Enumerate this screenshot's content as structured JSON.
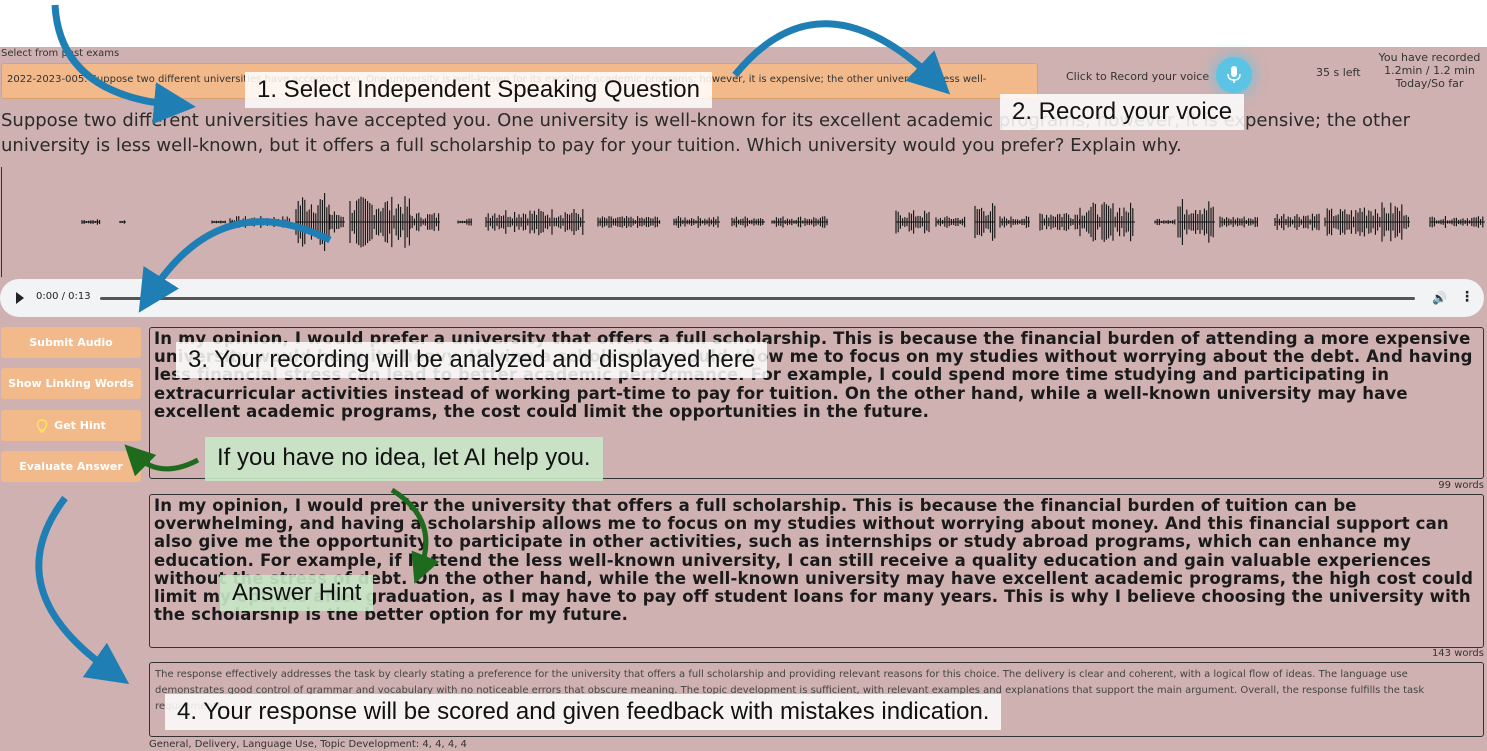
{
  "header": {
    "select_label": "Select from past exams",
    "selected_question": "2022-2023-005. Suppose two different universities have accepted you. One university is well-known for its excellent academic programs; however, it is expensive; the other university is less well-",
    "record_label": "Click to Record your voice",
    "timer": "35 s left",
    "stats_line1": "You have recorded",
    "stats_line2": "1.2min / 1.2 min",
    "stats_line3": "Today/So far"
  },
  "question_text": "Suppose two different universities have accepted you. One university is well-known for its excellent academic programs; however, it is expensive; the other university is less well-known, but it offers a full scholarship to pay for your tuition. Which university would you prefer? Explain why.",
  "audio": {
    "time": "0:00 / 0:13"
  },
  "buttons": {
    "submit": "Submit Audio",
    "linking": "Show Linking Words",
    "hint": "Get Hint",
    "evaluate": "Evaluate Answer"
  },
  "transcript": {
    "text": "In my opinion, I would prefer a university that offers a full scholarship. This is because the financial burden of attending a more expensive university would be quite heavy. Having a scholarship would allow me to focus on my studies without worrying about the debt. And having less financial stress can lead to better academic performance. For example, I could spend more time studying and participating in extracurricular activities instead of working part-time to pay for tuition. On the other hand, while a well-known university may have excellent academic programs, the cost could limit the opportunities in the future.",
    "word_count": "99 words"
  },
  "hint": {
    "text": "In my opinion, I would prefer the university that offers a full scholarship. This is because the financial burden of tuition can be overwhelming, and having a scholarship allows me to focus on my studies without worrying about money. And this financial support can also give me the opportunity to participate in other activities, such as internships or study abroad programs, which can enhance my education. For example, if I attend the less well-known university, I can still receive a quality education and gain valuable experiences without the stress of debt. On the other hand, while the well-known university may have excellent academic programs, the high cost could limit my options after graduation, as I may have to pay off student loans for many years. This is why I believe choosing the university with the scholarship is the better option for my future.",
    "word_count": "143 words"
  },
  "feedback": {
    "text": "The response effectively addresses the task by clearly stating a preference for the university that offers a full scholarship and providing relevant reasons for this choice. The delivery is clear and coherent, with a logical flow of ideas. The language use demonstrates good control of grammar and vocabulary with no noticeable errors that obscure meaning. The topic development is sufficient, with relevant examples and explanations that support the main argument. Overall, the response fulfills the task requirements.",
    "scores": "General, Delivery, Language Use, Topic Development: 4, 4, 4, 4"
  },
  "callouts": {
    "step1": "1. Select Independent Speaking Question",
    "step2": "2. Record your voice",
    "step3": "3. Your recording will be analyzed and displayed here",
    "ai_help": "If you have no idea,  let AI help you.",
    "answer_hint": "Answer Hint",
    "step4": "4. Your response will be scored and given feedback with mistakes indication."
  },
  "colors": {
    "background": "#cfb1b1",
    "button": "#f2b98b",
    "mic": "#5bc3e4",
    "arrow_blue": "#1f7fb5",
    "arrow_green": "#1e6b1e"
  }
}
